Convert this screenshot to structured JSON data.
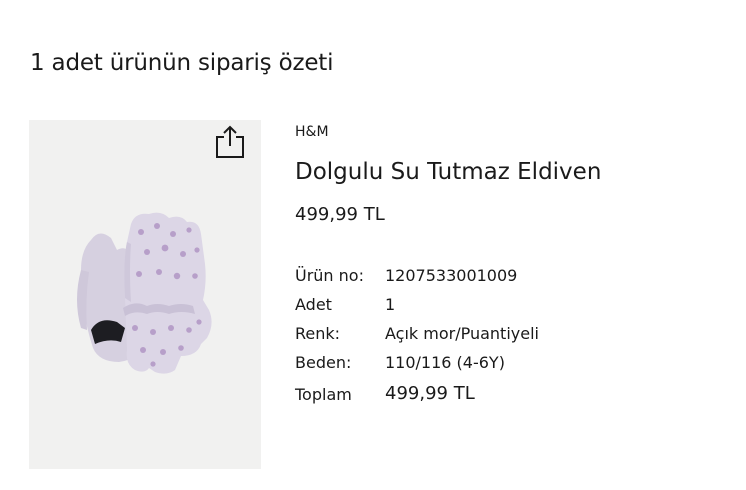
{
  "summary": {
    "title": "1 adet ürünün sipariş özeti"
  },
  "product": {
    "brand": "H&M",
    "name": "Dolgulu Su Tutmaz Eldiven",
    "price": "499,99 TL",
    "image_icon": "glove-product-image",
    "share_icon": "share-icon"
  },
  "details": [
    {
      "label": "Ürün no:",
      "value": "1207533001009"
    },
    {
      "label": "Adet",
      "value": "1"
    },
    {
      "label": "Renk:",
      "value": "Açık mor/Puantiyeli"
    },
    {
      "label": "Beden:",
      "value": "110/116 (4-6Y)"
    },
    {
      "label": "Toplam",
      "value": "499,99 TL"
    }
  ],
  "colors": {
    "image_background": "#f1f1f0",
    "glove_lilac": "#d9d3e3",
    "dot_purple": "#b79fc9",
    "text": "#1a1a1a"
  }
}
